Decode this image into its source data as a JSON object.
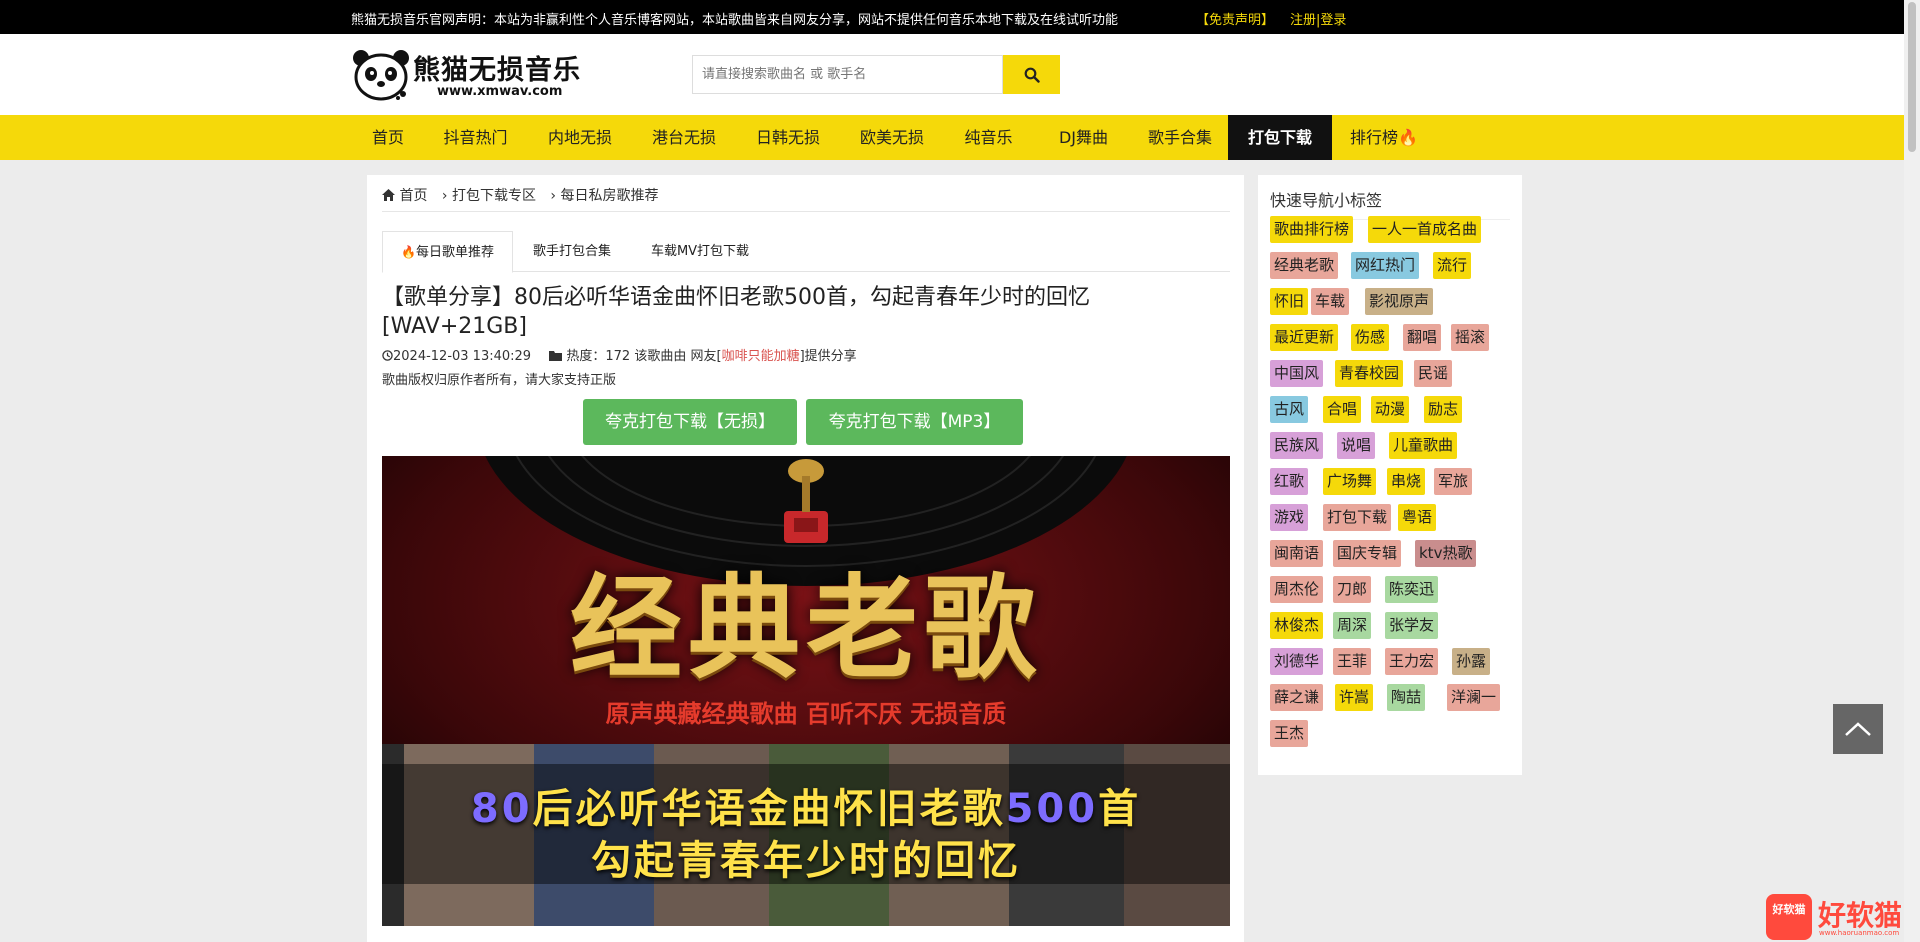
{
  "topbar": {
    "notice": "熊猫无损音乐官网声明：本站为非赢利性个人音乐博客网站，本站歌曲皆来自网友分享，网站不提供任何音乐本地下载及在线试听功能",
    "disclaimer": "【免责声明】",
    "register": "注册",
    "separator": "|",
    "login": "登录"
  },
  "logo": {
    "brand": "熊猫无损音乐",
    "url": "www.xmwav.com"
  },
  "search": {
    "placeholder": "请直接搜索歌曲名 或 歌手名"
  },
  "nav": [
    {
      "label": "首页"
    },
    {
      "label": "抖音热门"
    },
    {
      "label": "内地无损"
    },
    {
      "label": "港台无损"
    },
    {
      "label": "日韩无损"
    },
    {
      "label": "欧美无损"
    },
    {
      "label": "纯音乐"
    },
    {
      "label": "DJ舞曲"
    },
    {
      "label": "歌手合集"
    },
    {
      "label": "打包下载"
    },
    {
      "label": "排行榜"
    }
  ],
  "breadcrumb": {
    "home": "首页",
    "sep": "›",
    "level1": "打包下载专区",
    "level2": "每日私房歌推荐"
  },
  "tabs": [
    {
      "label": "每日歌单推荐"
    },
    {
      "label": "歌手打包合集"
    },
    {
      "label": "车载MV打包下载"
    }
  ],
  "post": {
    "title": "【歌单分享】80后必听华语金曲怀旧老歌500首，勾起青春年少时的回忆[WAV+21GB]",
    "date": "2024-12-03 13:40:29",
    "heat_label": "热度：",
    "heat": "172",
    "share_prefix": "该歌曲由 网友[",
    "sharer": "咖啡只能加糖",
    "share_suffix": "]提供分享",
    "copyright": "歌曲版权归原作者所有，请大家支持正版",
    "download_lossless": "夸克打包下载【无损】",
    "download_mp3": "夸克打包下载【MP3】"
  },
  "banner": {
    "headline": "经典老歌",
    "tagline": "原声典藏经典歌曲 百听不厌 无损音质",
    "caption1_num1": "80",
    "caption1_mid": "后必听华语金曲怀旧老歌",
    "caption1_num2": "500",
    "caption1_end": "首",
    "caption2": "勾起青春年少时的回忆"
  },
  "sidebar": {
    "heading": "快速导航小标签",
    "tags": [
      {
        "label": "歌曲排行榜",
        "color": "#f5d90a"
      },
      {
        "label": "一人一首成名曲",
        "color": "#f5d90a"
      },
      {
        "label": "经典老歌",
        "color": "#e8a69a"
      },
      {
        "label": "网红热门",
        "color": "#88c9e0"
      },
      {
        "label": "流行",
        "color": "#f5d90a"
      },
      {
        "label": "怀旧",
        "color": "#f5d90a"
      },
      {
        "label": "车载",
        "color": "#e8a69a"
      },
      {
        "label": "影视原声",
        "color": "#c8b088"
      },
      {
        "label": "最近更新",
        "color": "#f5d90a"
      },
      {
        "label": "伤感",
        "color": "#f5d90a"
      },
      {
        "label": "翻唱",
        "color": "#e8a69a"
      },
      {
        "label": "摇滚",
        "color": "#e8a69a"
      },
      {
        "label": "中国风",
        "color": "#d7a0d8"
      },
      {
        "label": "青春校园",
        "color": "#f5d90a"
      },
      {
        "label": "民谣",
        "color": "#e8a69a"
      },
      {
        "label": "古风",
        "color": "#88c9e0"
      },
      {
        "label": "合唱",
        "color": "#f5d90a"
      },
      {
        "label": "动漫",
        "color": "#f5d90a"
      },
      {
        "label": "励志",
        "color": "#f5d90a"
      },
      {
        "label": "民族风",
        "color": "#d7a0d8"
      },
      {
        "label": "说唱",
        "color": "#d7a0d8"
      },
      {
        "label": "儿童歌曲",
        "color": "#f5d90a"
      },
      {
        "label": "红歌",
        "color": "#d7a0d8"
      },
      {
        "label": "广场舞",
        "color": "#f5d90a"
      },
      {
        "label": "串烧",
        "color": "#f5d90a"
      },
      {
        "label": "军旅",
        "color": "#e8a69a"
      },
      {
        "label": "游戏",
        "color": "#d7a0d8"
      },
      {
        "label": "打包下载",
        "color": "#e8a69a"
      },
      {
        "label": "粤语",
        "color": "#f5d90a"
      },
      {
        "label": "闽南语",
        "color": "#e8a69a"
      },
      {
        "label": "国庆专辑",
        "color": "#e8a69a"
      },
      {
        "label": "ktv热歌",
        "color": "#c98d8d"
      },
      {
        "label": "周杰伦",
        "color": "#e8a69a"
      },
      {
        "label": "刀郎",
        "color": "#e8a69a"
      },
      {
        "label": "陈奕迅",
        "color": "#a8d8a0"
      },
      {
        "label": "林俊杰",
        "color": "#f5d90a"
      },
      {
        "label": "周深",
        "color": "#a8d8a0"
      },
      {
        "label": "张学友",
        "color": "#a8d8a0"
      },
      {
        "label": "刘德华",
        "color": "#d7a0d8"
      },
      {
        "label": "王菲",
        "color": "#e8a69a"
      },
      {
        "label": "王力宏",
        "color": "#e8a69a"
      },
      {
        "label": "孙露",
        "color": "#c8b088"
      },
      {
        "label": "薛之谦",
        "color": "#e8a69a"
      },
      {
        "label": "许嵩",
        "color": "#f5d90a"
      },
      {
        "label": "陶喆",
        "color": "#a8d8a0"
      },
      {
        "label": "洋澜一",
        "color": "#e8a69a"
      },
      {
        "label": "王杰",
        "color": "#e8a69a"
      }
    ]
  },
  "watermark": {
    "box": "好软猫",
    "text": "好软猫",
    "url": "www.haoruanmao.com"
  }
}
